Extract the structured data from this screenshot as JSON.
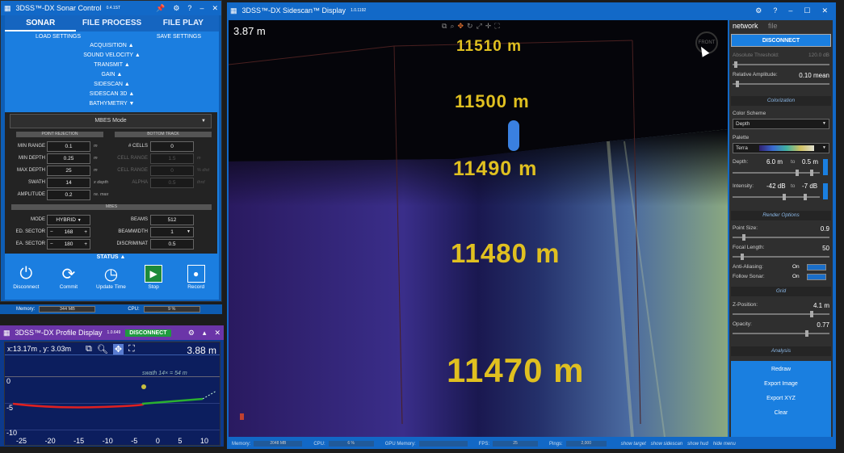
{
  "sonar_control": {
    "title": "3DSS™-DX Sonar Control",
    "version": "0.4.1ST",
    "tabs": [
      "SONAR",
      "FILE PROCESS",
      "FILE PLAY"
    ],
    "load_settings": "LOAD SETTINGS",
    "save_settings": "SAVE SETTINGS",
    "menu": [
      "ACQUISITION ▲",
      "SOUND VELOCITY ▲",
      "TRANSMIT ▲",
      "GAIN ▲",
      "SIDESCAN ▲",
      "SIDESCAN 3D ▲",
      "BATHYMETRY ▼"
    ],
    "mode": "MBES Mode",
    "point_rejection_header": "POINT REJECTION",
    "bottom_track_header": "BOTTOM TRACK",
    "pr": [
      {
        "label": "MIN RANGE",
        "value": "0.1",
        "unit": "m"
      },
      {
        "label": "MIN DEPTH",
        "value": "0.25",
        "unit": "m"
      },
      {
        "label": "MAX DEPTH",
        "value": "25",
        "unit": "m"
      },
      {
        "label": "SWATH",
        "value": "14",
        "unit": "x depth"
      },
      {
        "label": "AMPLITUDE",
        "value": "0.2",
        "unit": "re. max"
      }
    ],
    "bt": [
      {
        "label": "# CELLS",
        "value": "0",
        "unit": ""
      },
      {
        "label": "CELL RANGE",
        "value": "1.5",
        "unit": "m"
      },
      {
        "label": "CELL RANGE",
        "value": "0",
        "unit": "% dist"
      },
      {
        "label": "ALPHA",
        "value": "0.5",
        "unit": "thrd"
      }
    ],
    "mbes_header": "MBES",
    "mbes_left": [
      {
        "label": "MODE",
        "value": "HYBRID"
      },
      {
        "label": "ED. SECTOR",
        "value": "168"
      },
      {
        "label": "EA. SECTOR",
        "value": "180"
      }
    ],
    "mbes_right": [
      {
        "label": "BEAMS",
        "value": "512"
      },
      {
        "label": "BEAMWIDTH",
        "value": "1"
      },
      {
        "label": "DISCRIMINAT",
        "value": "0.5"
      }
    ],
    "status": "STATUS ▲",
    "buttons": [
      "Disconnect",
      "Commit",
      "Update Time",
      "Stop",
      "Record"
    ],
    "memory_label": "Memory:",
    "memory_value": "344 MB",
    "cpu_label": "CPU:",
    "cpu_value": "9 %"
  },
  "profile": {
    "title": "3DSS™-DX Profile Display",
    "version": "1.0.649",
    "disconnect": "DISCONNECT",
    "coords": "x:13.17m , y: 3.03m",
    "range": "3.88 m",
    "swath": "swath 14× = 54 m",
    "y_ticks": [
      "0",
      "-5",
      "-10"
    ],
    "x_ticks": [
      "-25",
      "-20",
      "-15",
      "-10",
      "-5",
      "0",
      "5",
      "10"
    ]
  },
  "sidescan": {
    "title": "3DSS™-DX Sidescan™ Display",
    "version": "1.0.1192",
    "range": "3.87 m",
    "depths": [
      "11510 m",
      "11500 m",
      "11490 m",
      "11480 m",
      "11470 m"
    ],
    "panel": {
      "tab_network": "network",
      "tab_file": "file",
      "disconnect": "DISCONNECT",
      "abs_threshold_label": "Absolute Threshold:",
      "abs_threshold_value": "120.0 dB",
      "rel_amp_label": "Relative Amplitude:",
      "rel_amp_value": "0.10 mean",
      "colorization": "Colorization",
      "color_scheme_label": "Color Scheme",
      "color_scheme_value": "Depth",
      "palette_label": "Palette",
      "palette_value": "Terra",
      "depth_label": "Depth:",
      "depth_from": "6.0 m",
      "depth_to": "0.5 m",
      "intensity_label": "Intensity:",
      "intensity_from": "-42 dB",
      "intensity_to": "-7 dB",
      "to": "to",
      "render_options": "Render Options",
      "point_size_label": "Point Size:",
      "point_size_value": "0.9",
      "focal_label": "Focal Length:",
      "focal_value": "50",
      "aa_label": "Anti-Aliasing:",
      "aa_value": "On",
      "follow_label": "Follow Sonar:",
      "follow_value": "On",
      "grid": "Grid",
      "zpos_label": "Z-Position:",
      "zpos_value": "4.1 m",
      "opacity_label": "Opacity:",
      "opacity_value": "0.77",
      "analysis": "Analysis",
      "redraw": "Redraw",
      "export_image": "Export Image",
      "export_xyz": "Export XYZ",
      "clear": "Clear"
    },
    "bottom": {
      "memory_label": "Memory:",
      "memory_value": "2048 MB",
      "cpu_label": "CPU:",
      "cpu_value": "6 %",
      "gpu_label": "GPU Memory:",
      "fps_label": "FPS:",
      "fps_value": "25",
      "pings_label": "Pings:",
      "pings_value": "2,000",
      "links": [
        "show target",
        "show sidescan",
        "show hud",
        "hide menu"
      ]
    }
  }
}
